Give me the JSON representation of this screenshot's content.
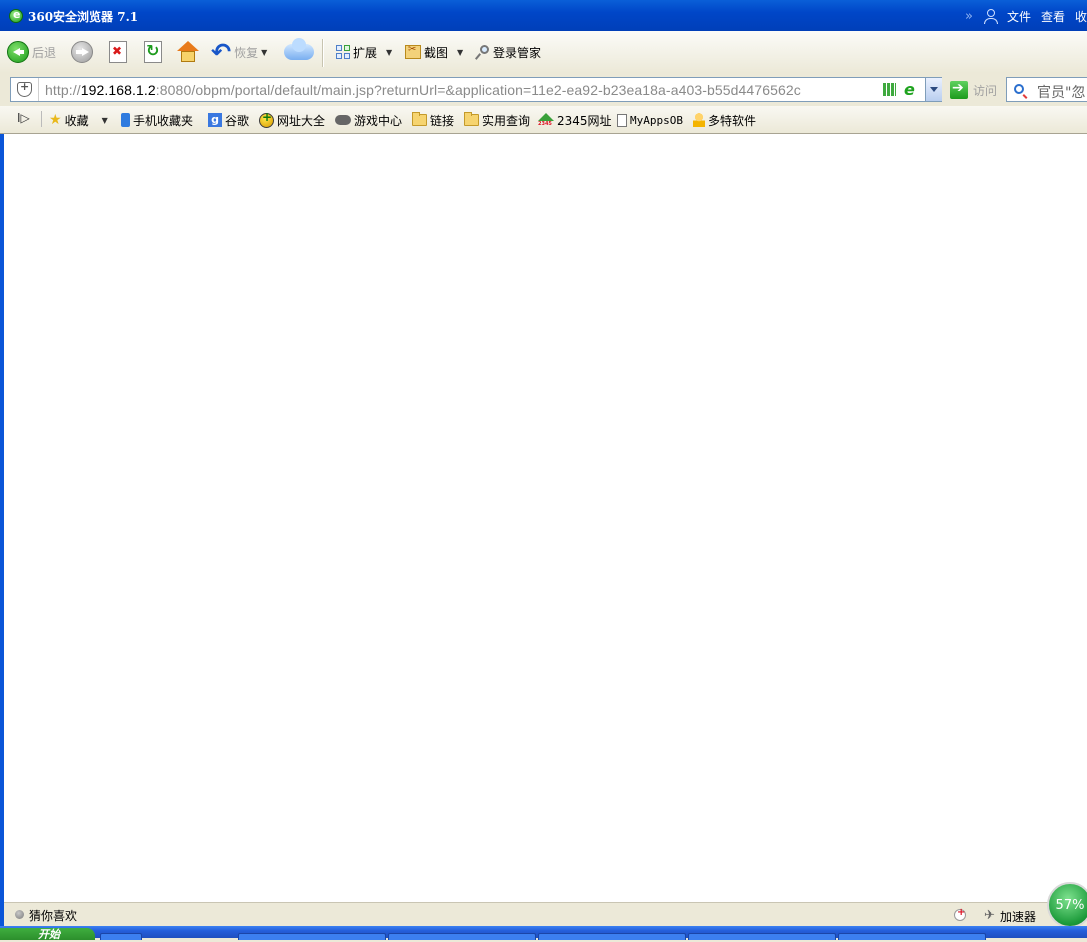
{
  "window": {
    "title": "360安全浏览器 7.1"
  },
  "title_menu": [
    "文件",
    "查看",
    "收"
  ],
  "toolbar": {
    "back_label": "后退",
    "restore_label": "恢复",
    "extensions_label": "扩展",
    "screenshot_label": "截图",
    "login_manager_label": "登录管家"
  },
  "address": {
    "url_prefix": "http://",
    "url_host": "192.168.1.2",
    "url_rest": ":8080/obpm/portal/default/main.jsp?returnUrl=&application=11e2-ea92-b23ea18a-a403-b55d4476562c",
    "go_label": "访问",
    "search_text": "官员\"忽"
  },
  "favorites": {
    "items": [
      {
        "label": "收藏",
        "icon": "star-icon"
      },
      {
        "label": "手机收藏夹",
        "icon": "phone-icon"
      },
      {
        "label": "谷歌",
        "icon": "google-icon"
      },
      {
        "label": "网址大全",
        "icon": "globe-icon"
      },
      {
        "label": "游戏中心",
        "icon": "gamepad-icon"
      },
      {
        "label": "链接",
        "icon": "folder-icon"
      },
      {
        "label": "实用查询",
        "icon": "folder-icon"
      },
      {
        "label": "2345网址",
        "icon": "2345-icon"
      },
      {
        "label": "MyAppsOB",
        "icon": "page-icon"
      },
      {
        "label": "多特软件",
        "icon": "person-icon"
      }
    ]
  },
  "status": {
    "left_text": "猜你喜欢",
    "accelerator_label": "加速器",
    "speed_percent": "57%"
  },
  "taskbar": {
    "start_label": "开始"
  }
}
